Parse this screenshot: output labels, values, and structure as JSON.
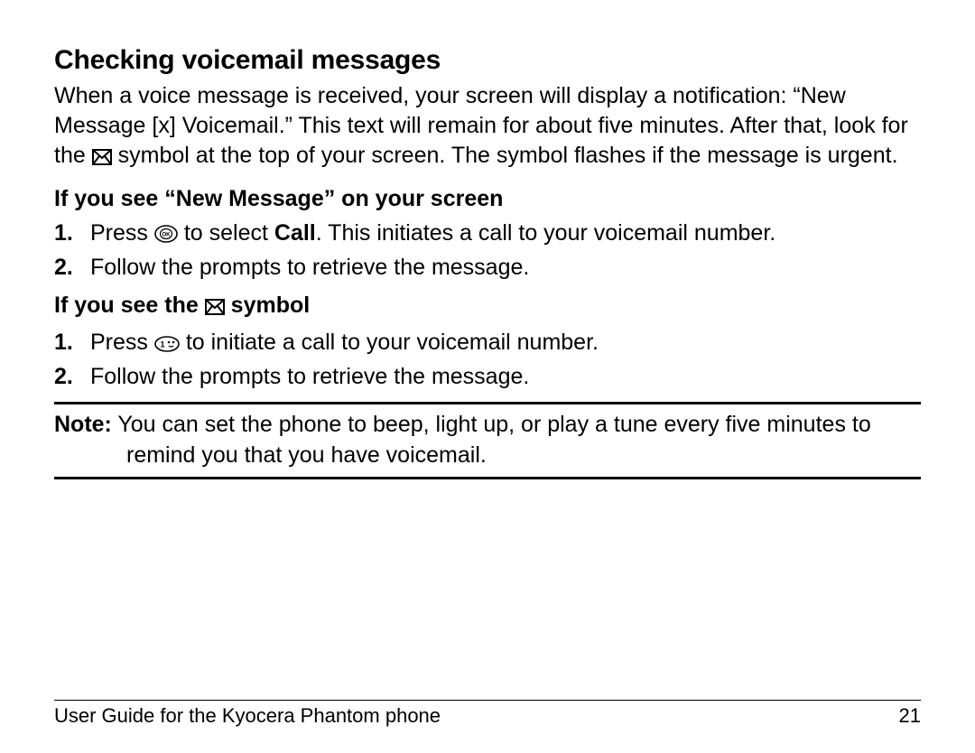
{
  "heading": "Checking voicemail messages",
  "intro_before_icon": "When a voice message is received, your screen will display a notification: “New Message [x] Voicemail.” This text will remain for about five minutes. After that, look for the ",
  "intro_after_icon": " symbol at the top of your screen. The symbol flashes if the message is urgent.",
  "section1": {
    "title": "If you see “New Message” on your screen",
    "step1_a": "Press ",
    "step1_b": " to select ",
    "step1_call": "Call",
    "step1_c": ". This initiates a call to your voicemail number.",
    "step2": "Follow the prompts to retrieve the message."
  },
  "section2": {
    "title_a": "If you see the ",
    "title_b": " symbol",
    "step1_a": "Press ",
    "step1_b": " to initiate a call to your voicemail number.",
    "step2": "Follow the prompts to retrieve the message."
  },
  "note": {
    "label": "Note:",
    "text": " You can set the phone to beep, light up, or play a tune every five minutes to remind you that you have voicemail."
  },
  "footer": {
    "left": "User Guide for the Kyocera Phantom phone",
    "right": "21"
  }
}
